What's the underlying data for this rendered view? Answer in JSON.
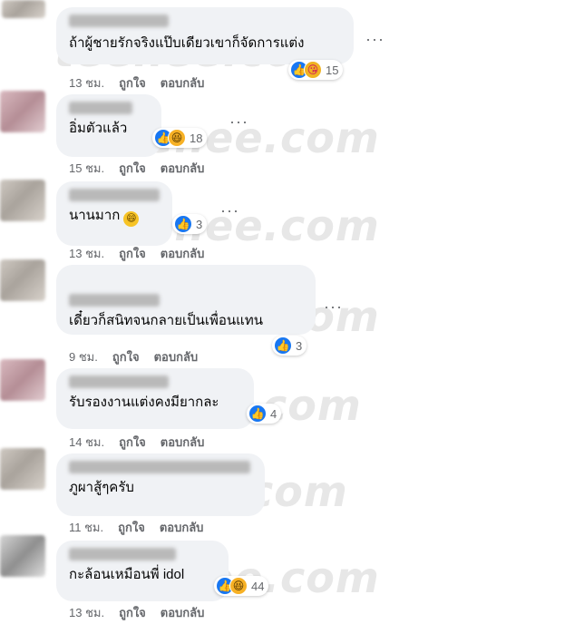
{
  "watermark": "teenee.com",
  "comments": [
    {
      "text": "ถ้าผู้ชายรักจริงแป๊บเดียวเขาก็จัดการแต่ง",
      "time": "13 ชม.",
      "like": "ถูกใจ",
      "reply": "ตอบกลับ",
      "reactions": [
        "like-icon",
        "love-icon"
      ],
      "count": "15"
    },
    {
      "name": "Net Chanok",
      "text": "อิ่มตัวแล้ว",
      "time": "15 ชม.",
      "like": "ถูกใจ",
      "reply": "ตอบกลับ",
      "reactions": [
        "like-icon",
        "haha-icon"
      ],
      "count": "18"
    },
    {
      "text": "นานมาก",
      "emoji": "😄",
      "time": "13 ชม.",
      "like": "ถูกใจ",
      "reply": "ตอบกลับ",
      "reactions": [
        "like-icon"
      ],
      "count": "3"
    },
    {
      "name": "Minch Minch",
      "text": "เดี๋ยวก็สนิทจนกลายเป็นเพื่อนแทน",
      "time": "9 ชม.",
      "like": "ถูกใจ",
      "reply": "ตอบกลับ",
      "reactions": [
        "like-icon"
      ],
      "count": "3"
    },
    {
      "text": "รับรองงานแต่งคงมียากละ",
      "time": "14 ชม.",
      "like": "ถูกใจ",
      "reply": "ตอบกลับ",
      "reactions": [
        "like-icon"
      ],
      "count": "4"
    },
    {
      "text": "ภูผาสู้ๆครับ",
      "time": "11 ชม.",
      "like": "ถูกใจ",
      "reply": "ตอบกลับ"
    },
    {
      "text": "กะล้อนเหมือนพี่ idol",
      "time": "13 ชม.",
      "like": "ถูกใจ",
      "reply": "ตอบกลับ",
      "reactions": [
        "like-icon",
        "haha-icon"
      ],
      "count": "44"
    }
  ],
  "more_icon": "more-options-icon",
  "colors": {
    "bubble": "#f0f2f5",
    "like": "#1877f2",
    "meta": "#65676b"
  }
}
